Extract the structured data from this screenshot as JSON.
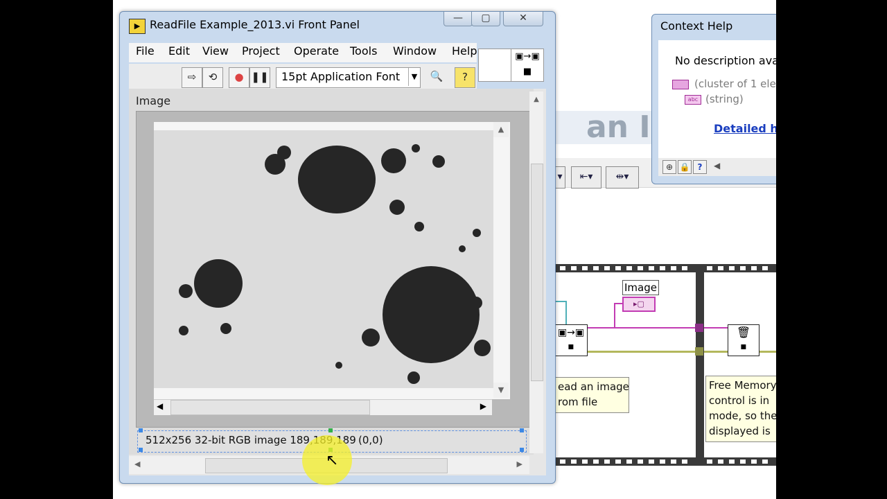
{
  "front_panel": {
    "title": "ReadFile Example_2013.vi Front Panel",
    "menu": [
      "File",
      "Edit",
      "View",
      "Project",
      "Operate",
      "Tools",
      "Window",
      "Help"
    ],
    "font_selector": "15pt Application Font",
    "image_label": "Image",
    "image_info": "512x256 32-bit RGB image 189,189,189",
    "image_coords": "(0,0)"
  },
  "context_help": {
    "title": "Context Help",
    "description": "No description ava",
    "cluster_type": "(cluster of 1 ele",
    "string_type": "(string)",
    "detailed_help_link": "Detailed he"
  },
  "block_diagram": {
    "image_label": "Image",
    "comment_read": [
      "ead an image",
      "rom file"
    ],
    "comment_free": [
      "Free Memory",
      "control is in",
      "mode, so the",
      "displayed is"
    ]
  },
  "colors": {
    "window_frame": "#c9daee",
    "wire_image": "#b3b85c",
    "wire_string": "#c23bb3",
    "cursor_highlight": "#f6f028"
  }
}
